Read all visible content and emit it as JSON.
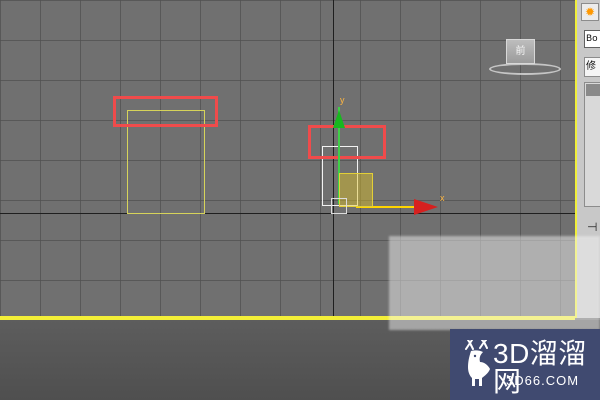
{
  "viewport": {
    "axes": {
      "x": "x",
      "y": "y"
    },
    "viewcube": {
      "label": "前"
    }
  },
  "right_panel": {
    "field_value": "Bo",
    "dropdown_value": "修"
  },
  "watermark": {
    "title": "3D溜溜网",
    "url": "3D66.COM"
  },
  "colors": {
    "highlight": "#f04b4b",
    "object_outline": "#d6d35a",
    "divider": "#f3ef38"
  },
  "icons": {
    "toolbar_icon": "settings-icon",
    "pin_icon": "pin-icon"
  }
}
